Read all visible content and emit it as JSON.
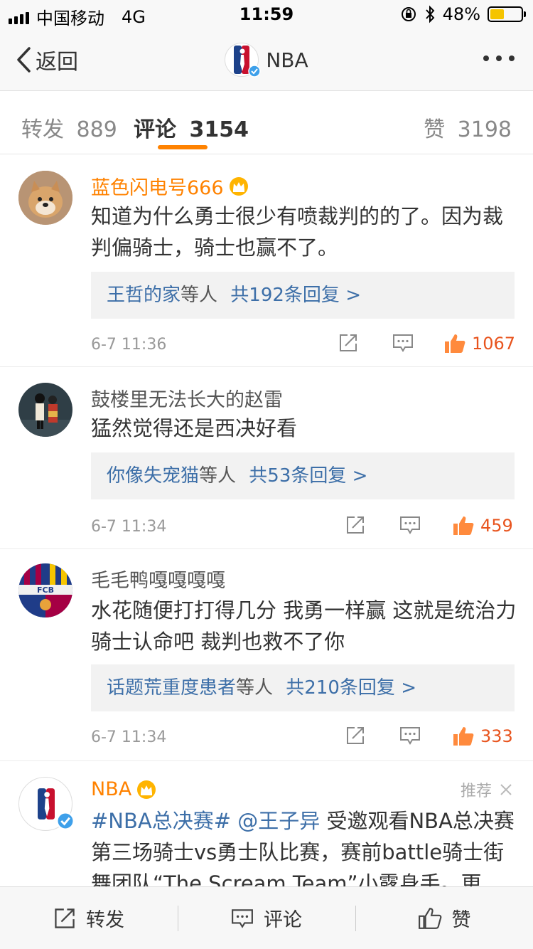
{
  "status_bar": {
    "carrier": "中国移动",
    "network": "4G",
    "time": "11:59",
    "battery": "48%",
    "battery_level": 0.48
  },
  "nav": {
    "back_label": "返回",
    "title": "NBA"
  },
  "tabs": [
    {
      "label": "转发",
      "count": "889"
    },
    {
      "label": "评论",
      "count": "3154"
    },
    {
      "label": "赞",
      "count": "3198"
    }
  ],
  "comments": [
    {
      "name": "蓝色闪电号666",
      "text": "知道为什么勇士很少有喷裁判的的了。因为裁判偏骑士，骑士也赢不了。",
      "reply_user": "王哲的家",
      "reply_mid": "等人",
      "reply_count": "共192条回复 >",
      "time": "6-7 11:36",
      "likes": "1067"
    },
    {
      "name": "鼓楼里无法长大的赵雷",
      "text": "猛然觉得还是西决好看",
      "reply_user": "你像失宠猫",
      "reply_mid": "等人",
      "reply_count": "共53条回复 >",
      "time": "6-7 11:34",
      "likes": "459"
    },
    {
      "name": "毛毛鸭嘎嘎嘎嘎",
      "text": "水花随便打打得几分 我勇一样赢 这就是统治力 骑士认命吧 裁判也救不了你",
      "reply_user": "话题荒重度患者",
      "reply_mid": "等人",
      "reply_count": "共210条回复 >",
      "time": "6-7 11:34",
      "likes": "333",
      "avatar_text": "FCB"
    },
    {
      "name": "NBA",
      "recommend": "推荐",
      "hashtag": "#NBA总决赛#",
      "mention": "@王子异",
      "text": "受邀观看NBA总决赛第三场骑士vs勇士队比赛，赛前battle骑士街舞团队“The Scream Team”小露身手。更"
    }
  ],
  "bottom_bar": {
    "repost": "转发",
    "comment": "评论",
    "like": "赞"
  },
  "colors": {
    "accent": "#ff8200",
    "link": "#3d6fa8",
    "like": "#e8541e"
  }
}
